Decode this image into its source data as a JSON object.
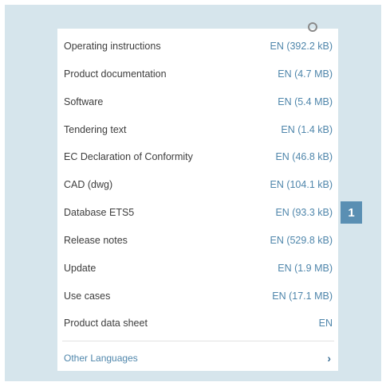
{
  "downloads": {
    "rows": [
      {
        "label": "Operating instructions",
        "value": "EN (392.2 kB)"
      },
      {
        "label": "Product documentation",
        "value": "EN (4.7 MB)"
      },
      {
        "label": "Software",
        "value": "EN (5.4 MB)"
      },
      {
        "label": "Tendering text",
        "value": "EN (1.4 kB)"
      },
      {
        "label": "EC Declaration of Conformity",
        "value": "EN (46.8 kB)"
      },
      {
        "label": "CAD (dwg)",
        "value": "EN (104.1 kB)"
      },
      {
        "label": "Database ETS5",
        "value": "EN (93.3 kB)"
      },
      {
        "label": "Release notes",
        "value": "EN (529.8 kB)"
      },
      {
        "label": "Update",
        "value": "EN (1.9 MB)"
      },
      {
        "label": "Use cases",
        "value": "EN (17.1 MB)"
      },
      {
        "label": "Product data sheet",
        "value": "EN"
      }
    ],
    "other_languages": "Other Languages",
    "other_languages_chevron": "›"
  },
  "callout": {
    "number": "1"
  },
  "colors": {
    "frame": "#d6e5ec",
    "link": "#4f86ab",
    "text": "#3d3d3d",
    "badge": "#5a8fb3"
  },
  "icons": {
    "scroll": "scroll-indicator-icon",
    "chevron": "chevron-right-icon"
  }
}
